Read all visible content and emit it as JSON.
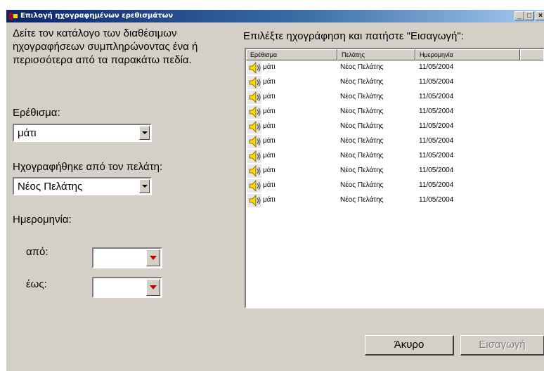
{
  "window": {
    "title": "Επιλογή ηχογραφημένων ερεθισμάτων",
    "controls": {
      "minimize": "_",
      "maximize": "□",
      "close": "×"
    }
  },
  "left_panel": {
    "instructions_lines": [
      "Δείτε τον κατάλογο των διαθέσιμων",
      "ηχογραφήσεων συμπληρώνοντας ένα ή",
      "περισσότερα από τα παρακάτω πεδία."
    ],
    "stimulus_label": "Ερέθισμα:",
    "stimulus_value": "μάτι",
    "client_label": "Ηχογραφήθηκε από τον πελάτη:",
    "client_value": "Νέος Πελάτης",
    "date_label": "Ημερομηνία:",
    "from_label": "από:",
    "to_label": "έως:",
    "from_value": "",
    "to_value": ""
  },
  "right_panel": {
    "instruction": "Επιλέξτε ηχογράφηση και πατήστε \"Εισαγωγή\":",
    "columns": [
      "Ερέθισμα",
      "Πελάτης",
      "Ημερομηνία"
    ],
    "row_icon": "speaker-icon",
    "rows": [
      [
        "μάτι",
        "Νέος Πελάτης",
        "11/05/2004"
      ],
      [
        "μάτι",
        "Νέος Πελάτης",
        "11/05/2004"
      ],
      [
        "μάτι",
        "Νέος Πελάτης",
        "11/05/2004"
      ],
      [
        "μάτι",
        "Νέος Πελάτης",
        "11/05/2004"
      ],
      [
        "μάτι",
        "Νέος Πελάτης",
        "11/05/2004"
      ],
      [
        "μάτι",
        "Νέος Πελάτης",
        "11/05/2004"
      ],
      [
        "μάτι",
        "Νέος Πελάτης",
        "11/05/2004"
      ],
      [
        "μάτι",
        "Νέος Πελάτης",
        "11/05/2004"
      ],
      [
        "μάτι",
        "Νέος Πελάτης",
        "11/05/2004"
      ],
      [
        "μάτι",
        "Νέος Πελάτης",
        "11/05/2004"
      ]
    ]
  },
  "buttons": {
    "cancel": "Άκυρο",
    "insert": "Εισαγωγή",
    "insert_enabled": false
  },
  "colors": {
    "titlebar_start": "#0a246a",
    "titlebar_end": "#a6caf0",
    "window_face": "#d4d0c8",
    "dropdown_arrow_red": "#c00000",
    "speaker_yellow": "#ffd800"
  }
}
